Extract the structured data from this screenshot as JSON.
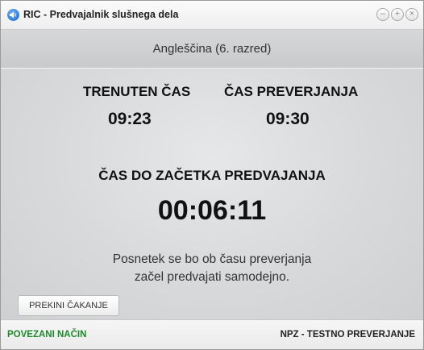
{
  "window": {
    "title": "RIC - Predvajalnik slušnega dela",
    "controls": {
      "minimize": "–",
      "maximize": "+",
      "close": "×"
    }
  },
  "header": {
    "subject": "Angleščina (6. razred)"
  },
  "main": {
    "current_time_label": "TRENUTEN ČAS",
    "current_time": "09:23",
    "check_time_label": "ČAS PREVERJANJA",
    "check_time": "09:30",
    "countdown_label": "ČAS DO ZAČETKA PREDVAJANJA",
    "countdown": "00:06:11",
    "note_line1": "Posnetek se bo ob času preverjanja",
    "note_line2": "začel predvajati samodejno.",
    "stop_button": "PREKINI ČAKANJE"
  },
  "status": {
    "left": "POVEZANI NAČIN",
    "right": "NPZ - TESTNO PREVERJANJE"
  },
  "colors": {
    "status_connected": "#1b8a2a",
    "app_icon": "#1463c8"
  }
}
